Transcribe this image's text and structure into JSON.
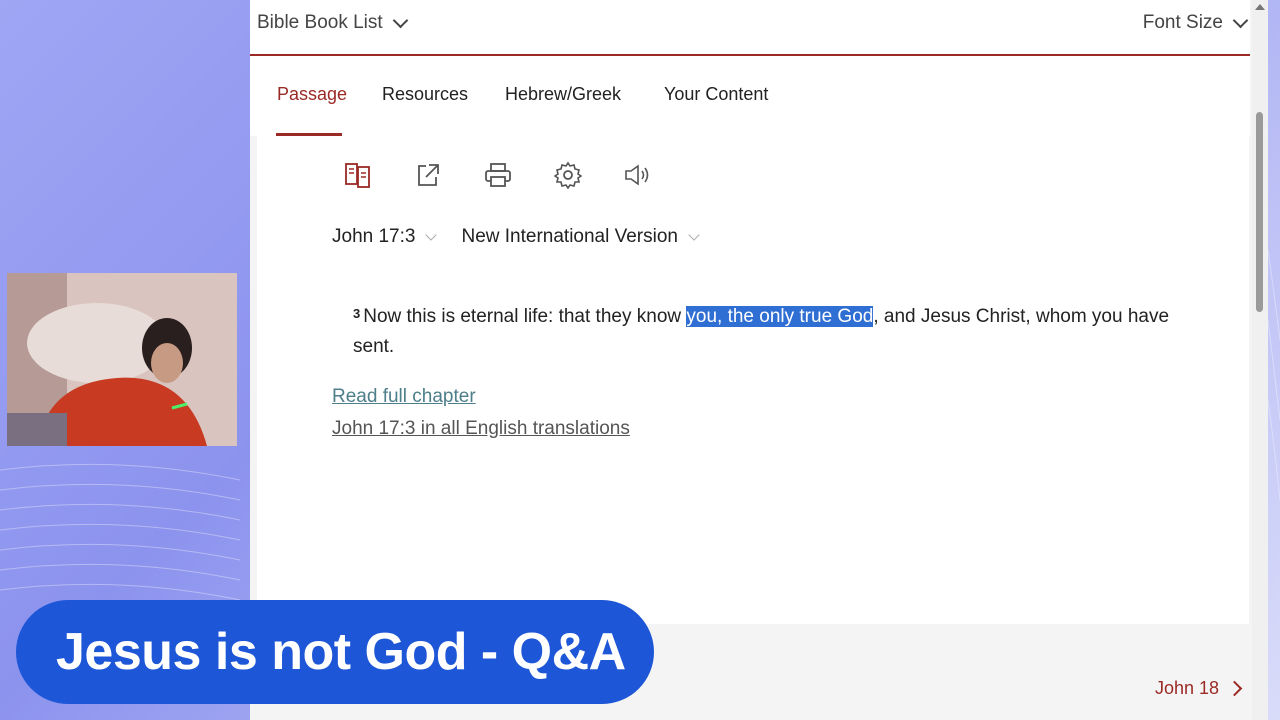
{
  "topbar": {
    "left_label": "Bible Book List",
    "right_label": "Font Size"
  },
  "tabs": [
    {
      "label": "Passage",
      "active": true
    },
    {
      "label": "Resources",
      "active": false
    },
    {
      "label": "Hebrew/Greek",
      "active": false
    },
    {
      "label": "Your Content",
      "active": false
    }
  ],
  "toolbar": {
    "icons": [
      "parallel-view-icon",
      "share-icon",
      "print-icon",
      "settings-gear-icon",
      "audio-speaker-icon"
    ]
  },
  "selectors": {
    "reference": "John 17:3",
    "version": "New International Version"
  },
  "verse": {
    "number": "3",
    "text_before": "Now this is eternal life: that they know ",
    "highlighted": "you, the only true God",
    "text_after": ", and Jesus Christ, whom you have sent."
  },
  "links": {
    "read_full_chapter": "Read full chapter",
    "all_translations": "John 17:3 in all English translations"
  },
  "next_chapter": "John 18",
  "banner": {
    "text": "Jesus is not God - Q&A"
  },
  "colors": {
    "accent": "#9b2a26",
    "highlight": "#2f6ed3",
    "banner": "#1d56d6"
  }
}
